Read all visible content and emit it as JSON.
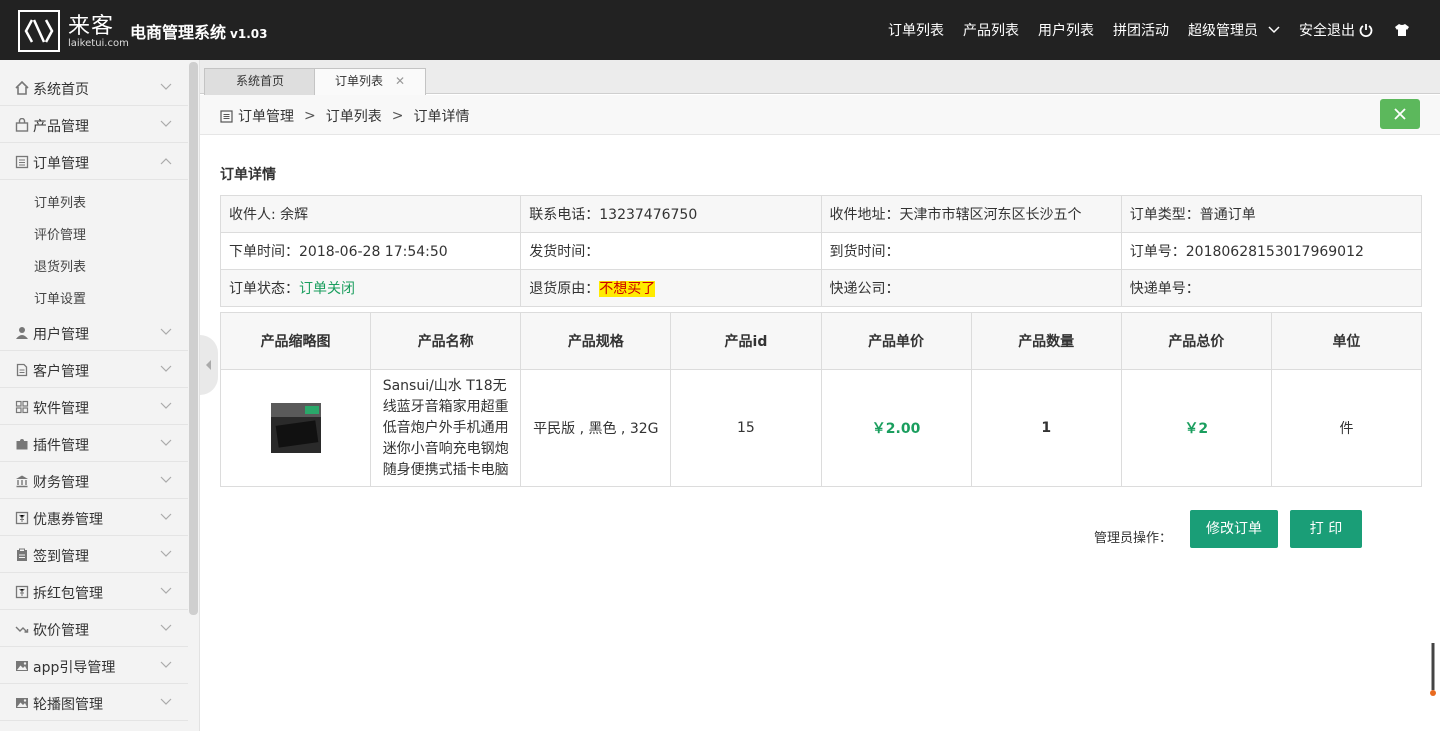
{
  "header": {
    "logo_name": "来客",
    "logo_domain": "laiketui.com",
    "title": "电商管理系统",
    "version": "v1.03",
    "nav": [
      "订单列表",
      "产品列表",
      "用户列表",
      "拼团活动"
    ],
    "admin": "超级管理员",
    "logout": "安全退出"
  },
  "sidebar": {
    "items": [
      {
        "label": "系统首页",
        "icon": "home-icon"
      },
      {
        "label": "产品管理",
        "icon": "bag-icon"
      },
      {
        "label": "订单管理",
        "icon": "list-icon"
      },
      {
        "label": "用户管理",
        "icon": "user-icon"
      },
      {
        "label": "客户管理",
        "icon": "file-icon"
      },
      {
        "label": "软件管理",
        "icon": "grid-icon"
      },
      {
        "label": "插件管理",
        "icon": "puzzle-icon"
      },
      {
        "label": "财务管理",
        "icon": "bank-icon"
      },
      {
        "label": "优惠券管理",
        "icon": "coupon-icon"
      },
      {
        "label": "签到管理",
        "icon": "clipboard-icon"
      },
      {
        "label": "拆红包管理",
        "icon": "redpacket-icon"
      },
      {
        "label": "砍价管理",
        "icon": "trend-icon"
      },
      {
        "label": "app引导管理",
        "icon": "image-icon"
      },
      {
        "label": "轮播图管理",
        "icon": "image-icon"
      }
    ],
    "sub_items": [
      "订单列表",
      "评价管理",
      "退货列表",
      "订单设置"
    ]
  },
  "tabs": [
    {
      "label": "系统首页"
    },
    {
      "label": "订单列表"
    }
  ],
  "breadcrumb": {
    "items": [
      "订单管理",
      "订单列表",
      "订单详情"
    ],
    "sep": ">"
  },
  "detail": {
    "title": "订单详情",
    "rows": [
      [
        "收件人: 余辉",
        "联系电话：13237476750",
        "收件地址：天津市市辖区河东区长沙五个",
        "订单类型：普通订单"
      ],
      [
        "下单时间：2018-06-28 17:54:50",
        "发货时间：",
        "到货时间：",
        "订单号：20180628153017969012"
      ],
      [
        "订单状态：",
        "退货原由：",
        "快递公司：",
        "快递单号："
      ]
    ],
    "status_value": "订单关闭",
    "reason_value": "不想买了"
  },
  "products": {
    "headers": [
      "产品缩略图",
      "产品名称",
      "产品规格",
      "产品id",
      "产品单价",
      "产品数量",
      "产品总价",
      "单位"
    ],
    "row": {
      "name": "Sansui/山水 T18无线蓝牙音箱家用超重低音炮户外手机通用迷你小音响充电钢炮随身便携式插卡电脑",
      "spec": "平民版 , 黑色 , 32G",
      "id": "15",
      "unit_price": "￥2.00",
      "quantity": "1",
      "total": "￥2",
      "unit": "件"
    }
  },
  "actions": {
    "label": "管理员操作：",
    "edit": "修改订单",
    "print": "打 印"
  },
  "colors": {
    "topbar": "#222222",
    "accent_green": "#1a9e77",
    "status_green": "#1a9e5e",
    "close_green": "#5cb85c",
    "highlight": "#ffeb00"
  }
}
